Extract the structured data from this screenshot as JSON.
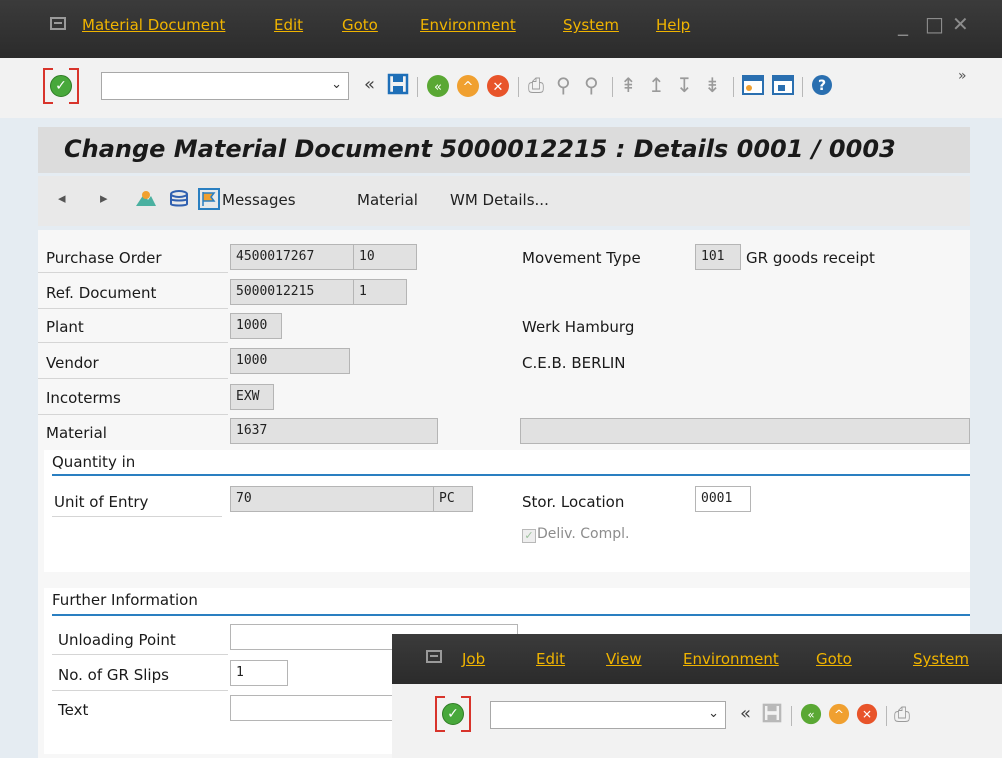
{
  "menu": {
    "items": [
      "Material Document",
      "Edit",
      "Goto",
      "Environment",
      "System",
      "Help"
    ]
  },
  "toolbar": {
    "double_left": "«",
    "more": "»"
  },
  "title": "Change Material Document 5000012215 : Details 0001 / 0003",
  "app_toolbar": {
    "messages": "Messages",
    "material": "Material",
    "wm_details": "WM Details..."
  },
  "fields": {
    "purchase_order": {
      "label": "Purchase Order",
      "value": "4500017267",
      "item": "10"
    },
    "movement_type": {
      "label": "Movement Type",
      "value": "101",
      "text": "GR goods receipt"
    },
    "ref_document": {
      "label": "Ref. Document",
      "value": "5000012215",
      "item": "1"
    },
    "plant": {
      "label": "Plant",
      "value": "1000",
      "text": "Werk Hamburg"
    },
    "vendor": {
      "label": "Vendor",
      "value": "1000",
      "text": "C.E.B. BERLIN"
    },
    "incoterms": {
      "label": "Incoterms",
      "value": "EXW"
    },
    "material": {
      "label": "Material",
      "value": "1637",
      "text": ""
    }
  },
  "quantity_group": {
    "title": "Quantity in",
    "unit_of_entry": {
      "label": "Unit of Entry",
      "value": "70",
      "unit": "PC"
    },
    "stor_location": {
      "label": "Stor. Location",
      "value": "0001"
    },
    "deliv_compl": {
      "label": "Deliv. Compl.",
      "checked": true
    }
  },
  "further_group": {
    "title": "Further Information",
    "unloading_point": {
      "label": "Unloading Point",
      "value": ""
    },
    "gr_slips": {
      "label": "No. of GR Slips",
      "value": "1"
    },
    "text": {
      "label": "Text",
      "value": ""
    }
  },
  "window2": {
    "menu": [
      "Job",
      "Edit",
      "View",
      "Environment",
      "Goto",
      "System"
    ],
    "double_left": "«"
  }
}
